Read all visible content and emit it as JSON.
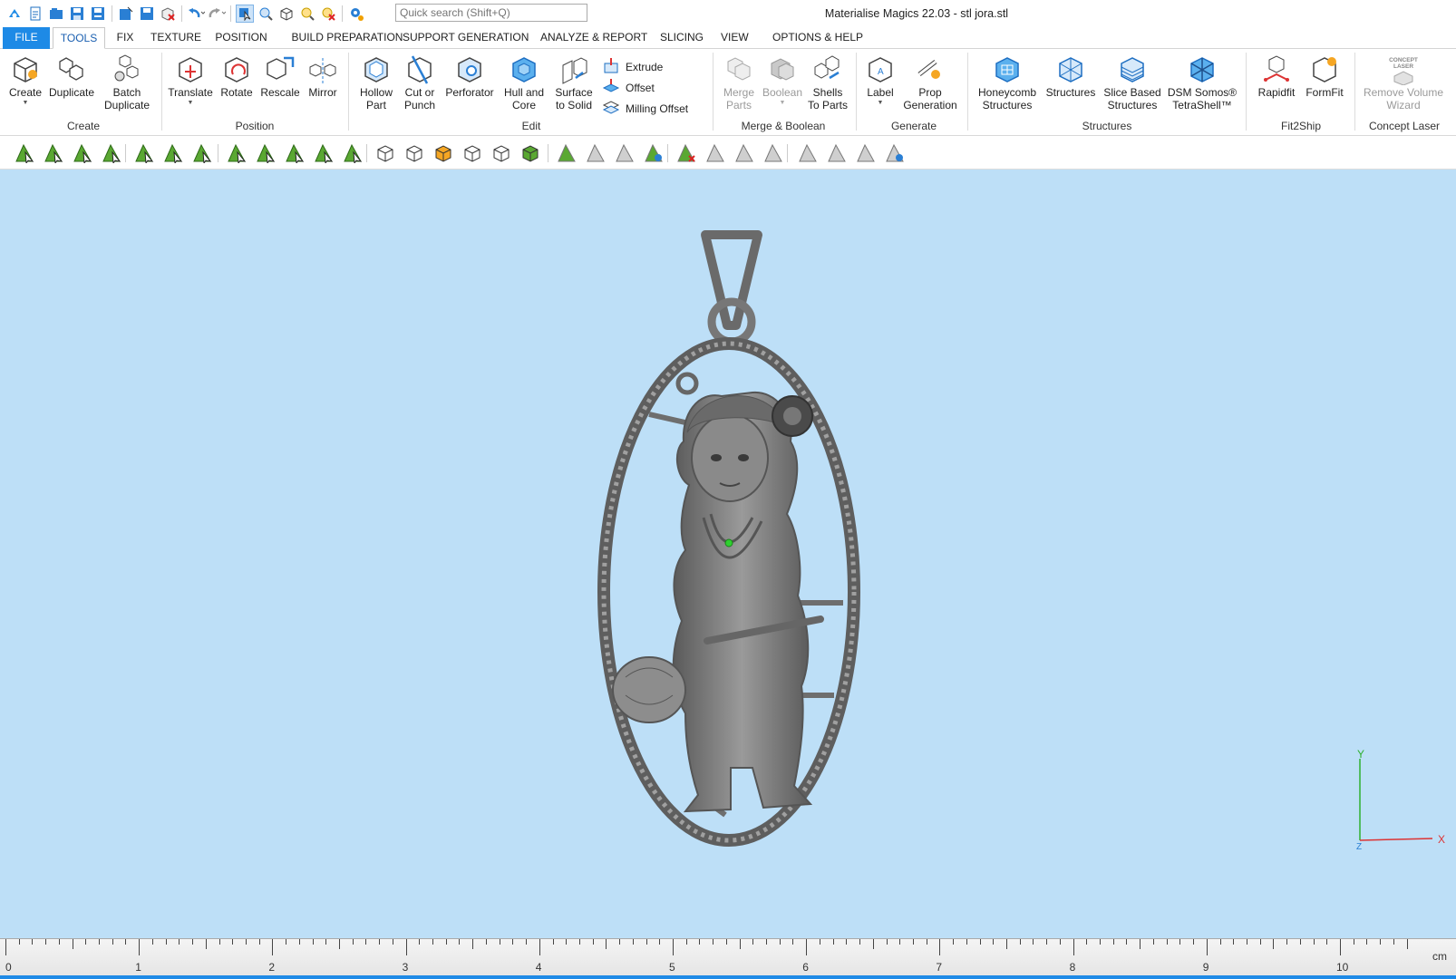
{
  "window": {
    "title": "Materialise Magics 22.03 - stl jora.stl",
    "search_placeholder": "Quick search (Shift+Q)"
  },
  "quick_access": [
    "app-logo-icon",
    "new-file-icon",
    "open-file-icon",
    "save-icon",
    "save-all-icon",
    "import-icon",
    "save-as-icon",
    "close-part-icon",
    "undo-icon",
    "redo-icon",
    "select-mode-icon",
    "zoom-part-icon",
    "view-cube-icon",
    "zoom-icon",
    "zoom-reset-icon",
    "settings-icon"
  ],
  "menu": {
    "file": "FILE",
    "tabs": [
      "TOOLS",
      "TEXTURE",
      "POSITION",
      "BUILD PREPARATION",
      "SUPPORT GENERATION",
      "ANALYZE & REPORT",
      "SLICING",
      "VIEW",
      "OPTIONS & HELP"
    ],
    "active": "TOOLS",
    "fix": "FIX"
  },
  "ribbon": {
    "create": {
      "label": "Create",
      "buttons": [
        "Create",
        "Duplicate",
        "Batch\nDuplicate"
      ]
    },
    "position": {
      "label": "Position",
      "buttons": [
        "Translate",
        "Rotate",
        "Rescale",
        "Mirror"
      ]
    },
    "edit": {
      "label": "Edit",
      "buttons": [
        "Hollow\nPart",
        "Cut or\nPunch",
        "Perforator",
        "Hull and\nCore",
        "Surface\nto Solid"
      ],
      "small": [
        "Extrude",
        "Offset",
        "Milling Offset"
      ]
    },
    "merge": {
      "label": "Merge & Boolean",
      "buttons": [
        "Merge\nParts",
        "Boolean",
        "Shells\nTo Parts"
      ]
    },
    "generate": {
      "label": "Generate",
      "buttons": [
        "Label",
        "Prop\nGeneration"
      ]
    },
    "structures": {
      "label": "Structures",
      "buttons": [
        "Honeycomb\nStructures",
        "Structures",
        "Slice Based\nStructures",
        "DSM Somos®\nTetraShell™"
      ]
    },
    "fit2ship": {
      "label": "Fit2Ship",
      "buttons": [
        "Rapidfit",
        "FormFit"
      ]
    },
    "concept": {
      "label": "Concept Laser",
      "buttons": [
        "Remove Volume\nWizard"
      ],
      "logo": "CONCEPT\nLASER"
    }
  },
  "colors": {
    "accent": "#1e8ae6",
    "viewport": "#bddff7",
    "tool_green": "#5aa832",
    "model": "#707070"
  },
  "axes": {
    "x": "X",
    "y": "Y",
    "z": "Z"
  },
  "ruler": {
    "unit": "cm",
    "labels": [
      "0",
      "1",
      "2",
      "3",
      "4",
      "5",
      "6",
      "7",
      "8",
      "9",
      "10"
    ]
  }
}
